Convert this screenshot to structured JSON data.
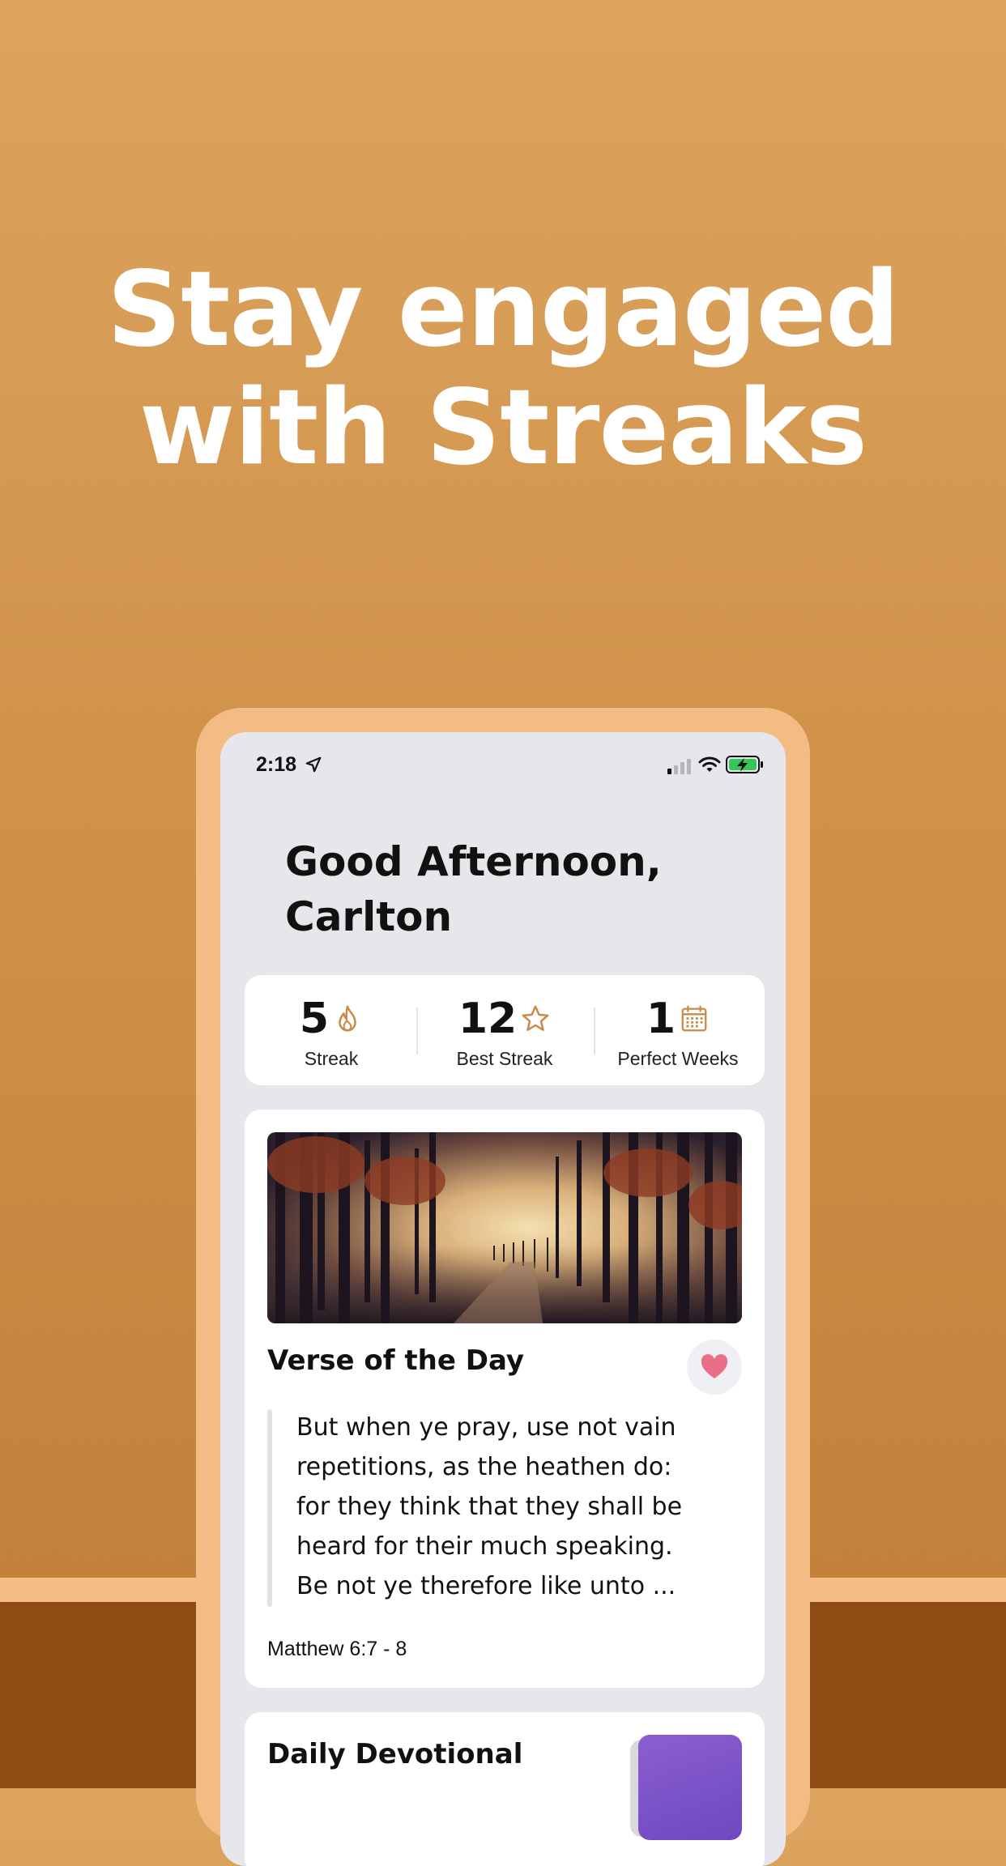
{
  "headline": {
    "line1": "Stay engaged",
    "line2": "with Streaks"
  },
  "colors": {
    "background_top": "#dca45f",
    "background_bottom": "#c2823c",
    "phone_frame": "#f3bc85",
    "ground": "#8e4b14",
    "accent_icon": "#c98a48",
    "heart": "#ea6e85",
    "devotional_thumb": "#7b52c8"
  },
  "status_bar": {
    "time": "2:18",
    "location_icon": "location-arrow-icon",
    "signal_icon": "cellular-signal-icon",
    "wifi_icon": "wifi-icon",
    "battery_icon": "battery-charging-icon"
  },
  "greeting": {
    "line1": "Good Afternoon,",
    "line2": "Carlton"
  },
  "stats": [
    {
      "value": "5",
      "label": "Streak",
      "icon": "flame-icon"
    },
    {
      "value": "12",
      "label": "Best Streak",
      "icon": "star-icon"
    },
    {
      "value": "1",
      "label": "Perfect Weeks",
      "icon": "calendar-icon"
    }
  ],
  "verse": {
    "title": "Verse of the Day",
    "favorite_icon": "heart-icon",
    "lines": [
      "But when ye pray, use not vain",
      "repetitions, as the heathen do:",
      "for they think that they shall be",
      "heard for their much speaking.",
      "Be not ye therefore like unto ..."
    ],
    "reference": "Matthew 6:7 - 8"
  },
  "devotional": {
    "title": "Daily Devotional"
  }
}
